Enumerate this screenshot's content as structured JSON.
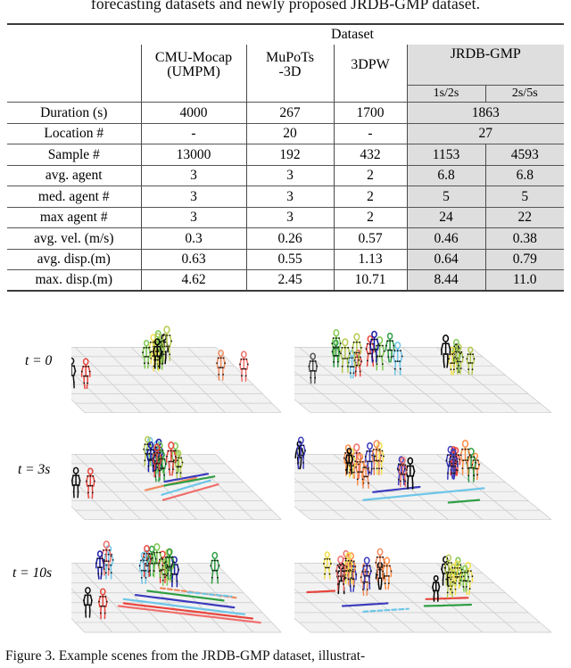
{
  "document": {
    "top_text": "forecasting datasets and newly proposed JRDB-GMP dataset.",
    "caption": "Figure 3. Example scenes from the JRDB-GMP dataset, illustrat-"
  },
  "table": {
    "group_header": "Dataset",
    "columns": [
      {
        "id": "rowlabel",
        "label": ""
      },
      {
        "id": "cmu",
        "label_line1": "CMU-Mocap",
        "label_line2": "(UMPM)",
        "shaded": false
      },
      {
        "id": "mupots",
        "label_line1": "MuPoTs",
        "label_line2": "-3D",
        "shaded": false
      },
      {
        "id": "3dpw",
        "label_line1": "3DPW",
        "label_line2": "",
        "shaded": false
      },
      {
        "id": "jrdb1",
        "group": "JRDB-GMP",
        "sublabel": "1s/2s",
        "shaded": true
      },
      {
        "id": "jrdb2",
        "group": "JRDB-GMP",
        "sublabel": "2s/5s",
        "shaded": true
      }
    ],
    "jrdb_group_label": "JRDB-GMP",
    "rows": [
      {
        "label": "Duration (s)",
        "cmu": "4000",
        "mupots": "267",
        "dpw": "1700",
        "jrdb_merged": "1863",
        "merged": true
      },
      {
        "label": "Location #",
        "cmu": "-",
        "mupots": "20",
        "dpw": "-",
        "jrdb_merged": "27",
        "merged": true
      },
      {
        "label": "Sample #",
        "cmu": "13000",
        "mupots": "192",
        "dpw": "432",
        "jrdb1": "1153",
        "jrdb2": "4593",
        "merged": false
      },
      {
        "label": "avg. agent",
        "cmu": "3",
        "mupots": "3",
        "dpw": "2",
        "jrdb1": "6.8",
        "jrdb2": "6.8",
        "merged": false
      },
      {
        "label": "med. agent #",
        "cmu": "3",
        "mupots": "3",
        "dpw": "2",
        "jrdb1": "5",
        "jrdb2": "5",
        "merged": false
      },
      {
        "label": "max agent #",
        "cmu": "3",
        "mupots": "3",
        "dpw": "2",
        "jrdb1": "24",
        "jrdb2": "22",
        "merged": false
      },
      {
        "label": "avg. vel. (m/s)",
        "cmu": "0.3",
        "mupots": "0.26",
        "dpw": "0.57",
        "jrdb1": "0.46",
        "jrdb2": "0.38",
        "merged": false
      },
      {
        "label": "avg. disp.(m)",
        "cmu": "0.63",
        "mupots": "0.55",
        "dpw": "1.13",
        "jrdb1": "0.64",
        "jrdb2": "0.79",
        "merged": false
      },
      {
        "label": "max. disp.(m)",
        "cmu": "4.62",
        "mupots": "2.45",
        "dpw": "10.71",
        "jrdb1": "8.44",
        "jrdb2": "11.0",
        "merged": false
      }
    ]
  },
  "figure": {
    "time_labels": [
      "t = 0",
      "t = 3s",
      "t = 10s"
    ],
    "panel_bg": "#f2f2f2",
    "grid_color": "#c9c9c9",
    "skeleton_palette": [
      "#000000",
      "#e8453c",
      "#f08a5d",
      "#7ec850",
      "#3b3bbd",
      "#6ec6e8",
      "#f2e04a",
      "#2f9e44",
      "#ef6f6c",
      "#b5c94f",
      "#ff8c42",
      "#1a1aa8"
    ]
  }
}
